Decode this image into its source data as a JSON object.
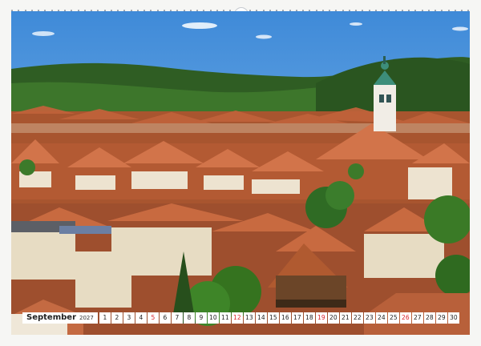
{
  "calendar": {
    "month": "September",
    "year": "2027",
    "days": [
      {
        "n": "1",
        "w": false
      },
      {
        "n": "2",
        "w": false
      },
      {
        "n": "3",
        "w": false
      },
      {
        "n": "4",
        "w": false
      },
      {
        "n": "5",
        "w": true
      },
      {
        "n": "6",
        "w": false
      },
      {
        "n": "7",
        "w": false
      },
      {
        "n": "8",
        "w": false
      },
      {
        "n": "9",
        "w": false
      },
      {
        "n": "10",
        "w": false
      },
      {
        "n": "11",
        "w": false
      },
      {
        "n": "12",
        "w": true
      },
      {
        "n": "13",
        "w": false
      },
      {
        "n": "14",
        "w": false
      },
      {
        "n": "15",
        "w": false
      },
      {
        "n": "16",
        "w": false
      },
      {
        "n": "17",
        "w": false
      },
      {
        "n": "18",
        "w": false
      },
      {
        "n": "19",
        "w": true
      },
      {
        "n": "20",
        "w": false
      },
      {
        "n": "21",
        "w": false
      },
      {
        "n": "22",
        "w": false
      },
      {
        "n": "23",
        "w": false
      },
      {
        "n": "24",
        "w": false
      },
      {
        "n": "25",
        "w": false
      },
      {
        "n": "26",
        "w": true
      },
      {
        "n": "27",
        "w": false
      },
      {
        "n": "28",
        "w": false
      },
      {
        "n": "29",
        "w": false
      },
      {
        "n": "30",
        "w": false
      }
    ]
  },
  "colors": {
    "sky": "#4a93dc",
    "hills": "#2e5a22",
    "roofs": "#b8532e",
    "weekend": "#d9202a"
  }
}
